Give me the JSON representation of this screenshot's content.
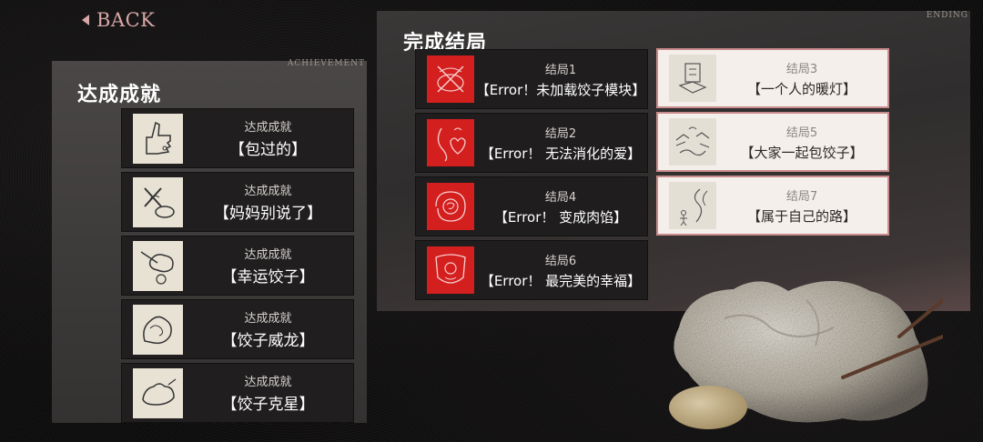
{
  "back": {
    "label": "BACK"
  },
  "achievements": {
    "tag": "ACHIEVEMENT",
    "title": "达成成就",
    "items": [
      {
        "sub": "达成成就",
        "name": "【包过的】",
        "icon": "thumbs-up-sketch-icon"
      },
      {
        "sub": "达成成就",
        "name": "【妈妈别说了】",
        "icon": "crossed-dumpling-sketch-icon"
      },
      {
        "sub": "达成成就",
        "name": "【幸运饺子】",
        "icon": "lucky-dumpling-sketch-icon"
      },
      {
        "sub": "达成成就",
        "name": "【饺子威龙】",
        "icon": "dragon-dumpling-sketch-icon"
      },
      {
        "sub": "达成成就",
        "name": "【饺子克星】",
        "icon": "dumpling-nemesis-sketch-icon"
      }
    ]
  },
  "endings": {
    "tag": "ENDING",
    "title": "完成结局",
    "items": [
      {
        "sub": "结局1",
        "name": "【Error！未加载饺子模块】",
        "style": "dark",
        "icon": "red-crossed-sketch-icon"
      },
      {
        "sub": "结局3",
        "name": "【一个人的暖灯】",
        "style": "light",
        "icon": "lamp-sketch-icon"
      },
      {
        "sub": "结局2",
        "name": "【Error！ 无法消化的爱】",
        "style": "dark",
        "icon": "red-heart-sketch-icon"
      },
      {
        "sub": "结局5",
        "name": "【大家一起包饺子】",
        "style": "light",
        "icon": "hands-sketch-icon"
      },
      {
        "sub": "结局4",
        "name": "【Error！ 变成肉馅】",
        "style": "dark",
        "icon": "red-swirl-sketch-icon"
      },
      {
        "sub": "结局7",
        "name": "【属于自己的路】",
        "style": "light",
        "icon": "road-sketch-icon"
      },
      {
        "sub": "结局6",
        "name": "【Error！ 最完美的幸福】",
        "style": "dark",
        "icon": "red-face-sketch-icon"
      }
    ]
  },
  "colors": {
    "accent": "#d9a7a7",
    "red": "#d41f1f",
    "lightBorder": "#c98b8b"
  }
}
